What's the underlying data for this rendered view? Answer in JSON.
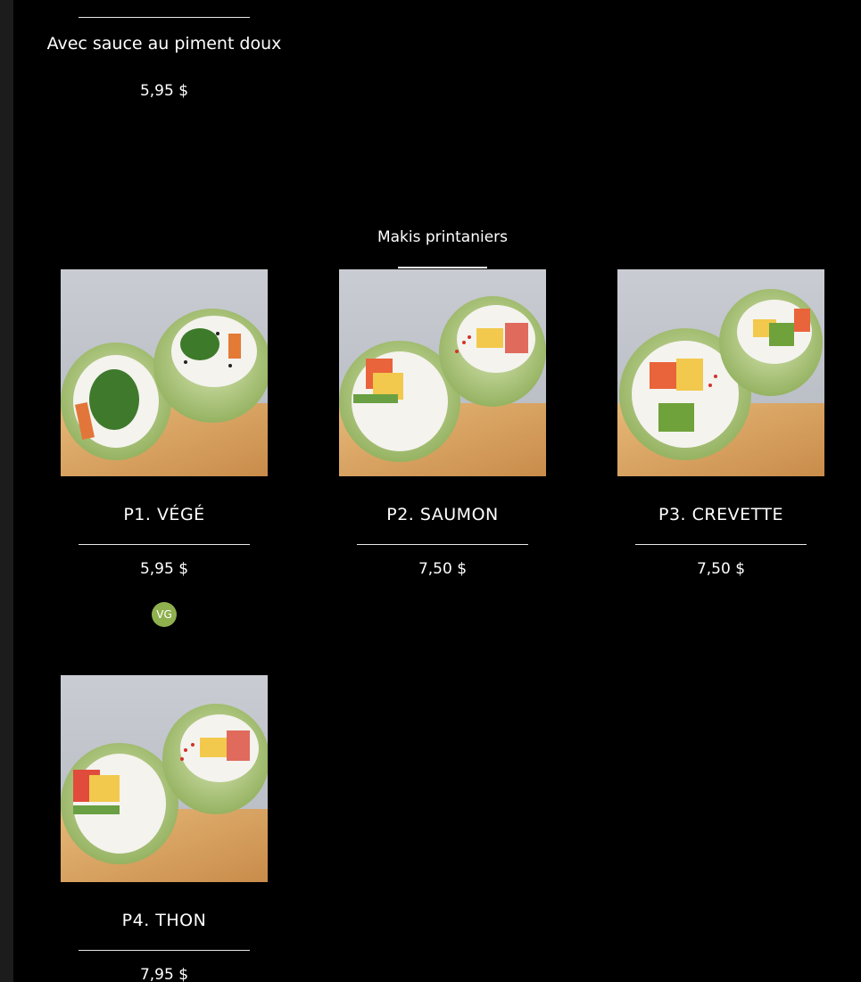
{
  "colors": {
    "background": "#000000",
    "rail": "#1c1c1c",
    "text": "#ffffff",
    "divider": "#e8e8e8",
    "vg_badge": "#8fb04e"
  },
  "previous_item": {
    "description": "Avec sauce au piment doux",
    "price": "5,95 $"
  },
  "section": {
    "title": "Makis printaniers"
  },
  "items": [
    {
      "name": "P1. VÉGÉ",
      "price": "5,95 $",
      "badge": "VG",
      "image": "vege-roll-photo"
    },
    {
      "name": "P2. SAUMON",
      "price": "7,50 $",
      "image": "saumon-roll-photo"
    },
    {
      "name": "P3. CREVETTE",
      "price": "7,50 $",
      "image": "crevette-roll-photo"
    },
    {
      "name": "P4. THON",
      "price": "7,95 $",
      "image": "thon-roll-photo"
    }
  ]
}
